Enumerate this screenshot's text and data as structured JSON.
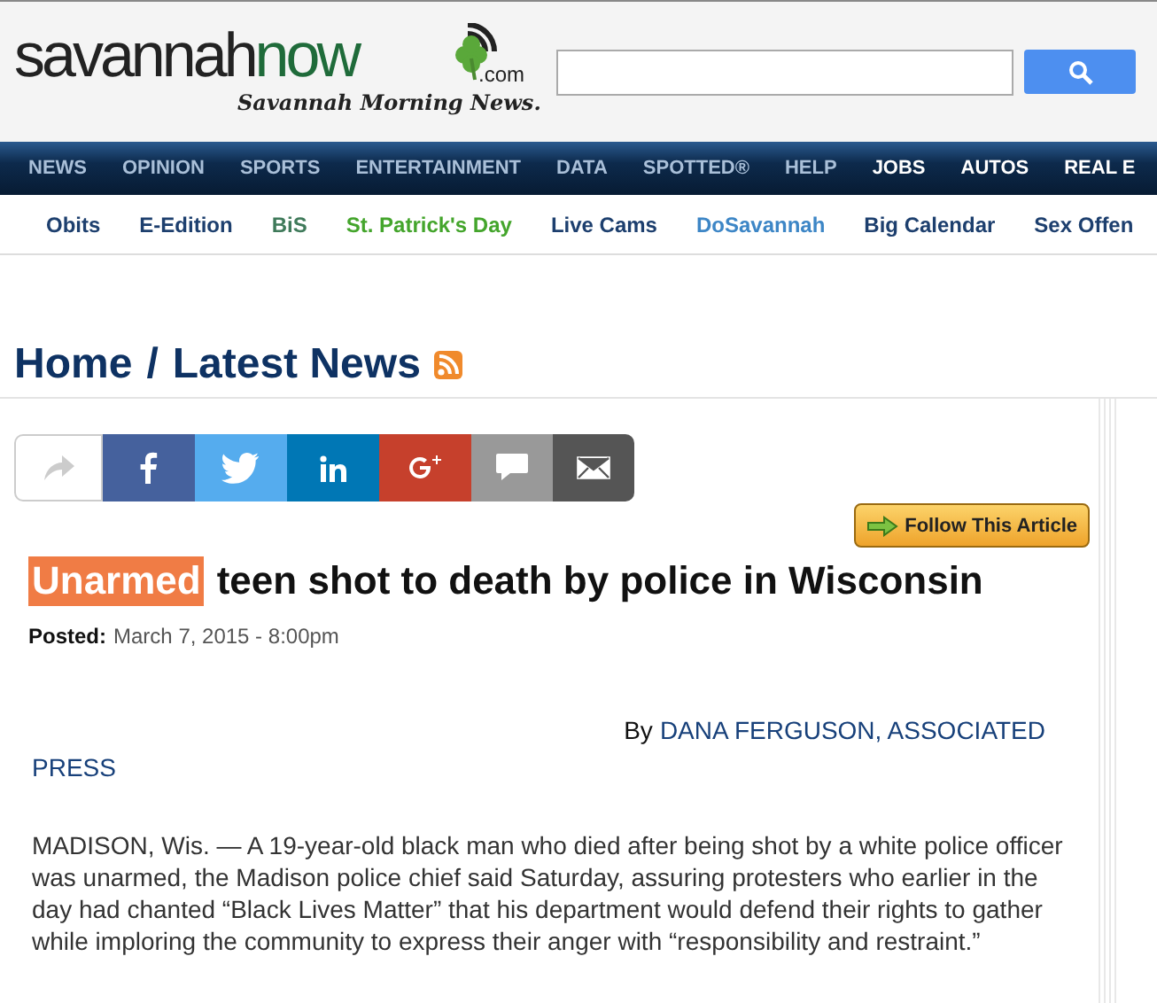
{
  "header": {
    "logo": {
      "word_dark": "savannah",
      "word_green": "now",
      "suffix": ".com",
      "tagline": "Savannah Morning News."
    }
  },
  "main_nav": [
    {
      "label": "NEWS",
      "highlight": false
    },
    {
      "label": "OPINION",
      "highlight": false
    },
    {
      "label": "SPORTS",
      "highlight": false
    },
    {
      "label": "ENTERTAINMENT",
      "highlight": false
    },
    {
      "label": "DATA",
      "highlight": false
    },
    {
      "label": "SPOTTED®",
      "highlight": false
    },
    {
      "label": "HELP",
      "highlight": false
    },
    {
      "label": "JOBS",
      "highlight": true
    },
    {
      "label": "AUTOS",
      "highlight": true
    },
    {
      "label": "REAL E",
      "highlight": true
    }
  ],
  "sub_nav": [
    {
      "label": "Obits",
      "color": "#1d3f6e"
    },
    {
      "label": "E-Edition",
      "color": "#1d3f6e"
    },
    {
      "label": "BiS",
      "color": "#3f7a5a"
    },
    {
      "label": "St. Patrick's Day",
      "color": "#44a52c"
    },
    {
      "label": "Live Cams",
      "color": "#1d3f6e"
    },
    {
      "label": "DoSavannah",
      "color": "#3d86c6"
    },
    {
      "label": "Big Calendar",
      "color": "#1d3f6e"
    },
    {
      "label": "Sex Offen",
      "color": "#1d3f6e"
    }
  ],
  "breadcrumb": {
    "home": "Home",
    "separator": "/",
    "section": "Latest News"
  },
  "share": [
    {
      "kind": "share"
    },
    {
      "kind": "facebook"
    },
    {
      "kind": "twitter"
    },
    {
      "kind": "linkedin"
    },
    {
      "kind": "googleplus"
    },
    {
      "kind": "comment"
    },
    {
      "kind": "email"
    }
  ],
  "follow_button": "Follow This Article",
  "article": {
    "headline_highlight": "Unarmed",
    "headline_rest": "teen shot to death by police in Wisconsin",
    "posted_label": "Posted:",
    "posted_date": "March 7, 2015 - 8:00pm",
    "byline_prefix": "By",
    "byline_author_lines": [
      "DANA FERGUSON, ASSOCIATED",
      "PRESS"
    ],
    "paragraph": "MADISON, Wis. — A 19-year-old black man who died after being shot by a white police officer was unarmed, the Madison police chief said Saturday, assuring protesters who earlier in the day had chanted “Black Lives Matter” that his department would defend their rights to gather while imploring the community to express their anger with “responsibility and restraint.”"
  }
}
